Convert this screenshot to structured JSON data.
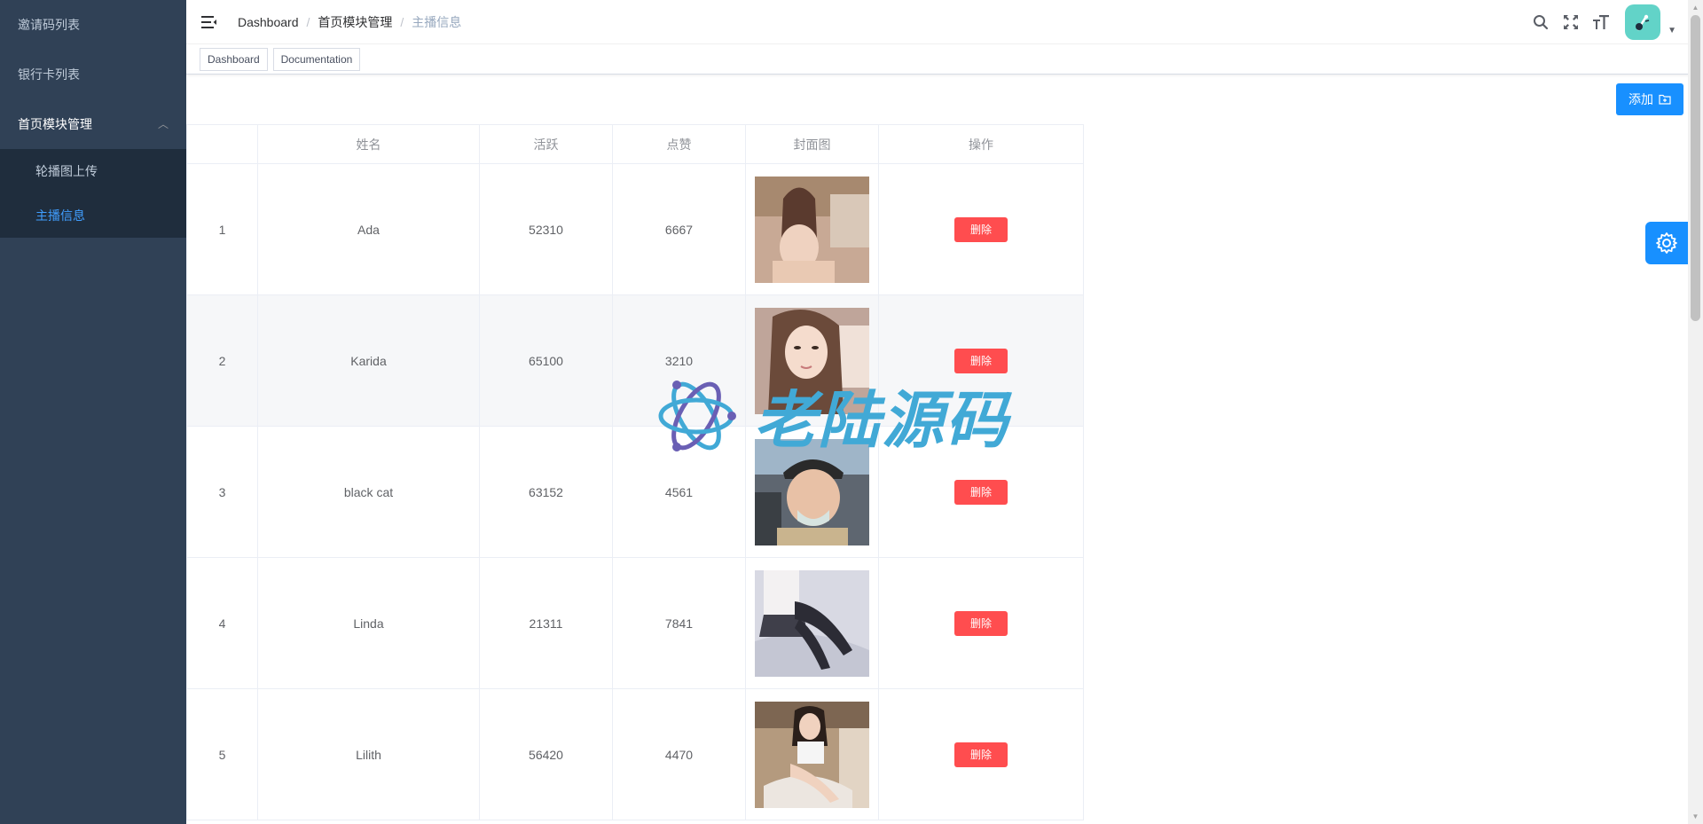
{
  "sidebar": {
    "items": [
      {
        "label": "邀请码列表"
      },
      {
        "label": "银行卡列表"
      },
      {
        "label": "首页模块管理",
        "arrow": "︿"
      }
    ],
    "submenu": [
      {
        "label": "轮播图上传"
      },
      {
        "label": "主播信息"
      }
    ]
  },
  "breadcrumb": {
    "items": [
      "Dashboard",
      "首页模块管理",
      "主播信息"
    ],
    "separator": "/"
  },
  "tags": [
    {
      "label": "Dashboard"
    },
    {
      "label": "Documentation"
    }
  ],
  "toolbar": {
    "add_label": "添加"
  },
  "table": {
    "headers": [
      "",
      "姓名",
      "活跃",
      "点赞",
      "封面图",
      "操作"
    ],
    "delete_label": "删除",
    "rows": [
      {
        "index": "1",
        "name": "Ada",
        "active": "52310",
        "likes": "6667"
      },
      {
        "index": "2",
        "name": "Karida",
        "active": "65100",
        "likes": "3210"
      },
      {
        "index": "3",
        "name": "black cat",
        "active": "63152",
        "likes": "4561"
      },
      {
        "index": "4",
        "name": "Linda",
        "active": "21311",
        "likes": "7841"
      },
      {
        "index": "5",
        "name": "Lilith",
        "active": "56420",
        "likes": "4470"
      }
    ]
  },
  "watermark": {
    "text": "老陆源码"
  },
  "colors": {
    "sidebar_bg": "#304156",
    "submenu_bg": "#1f2d3d",
    "accent": "#409eff",
    "primary_button": "#1890ff",
    "danger": "#ff4d4f",
    "watermark": "#41a9d6"
  },
  "icons": {
    "hamburger": "hamburger-icon",
    "search": "search-icon",
    "fullscreen": "fullscreen-icon",
    "font_size": "font-size-icon",
    "settings": "gear-icon",
    "add": "folder-add-icon"
  }
}
